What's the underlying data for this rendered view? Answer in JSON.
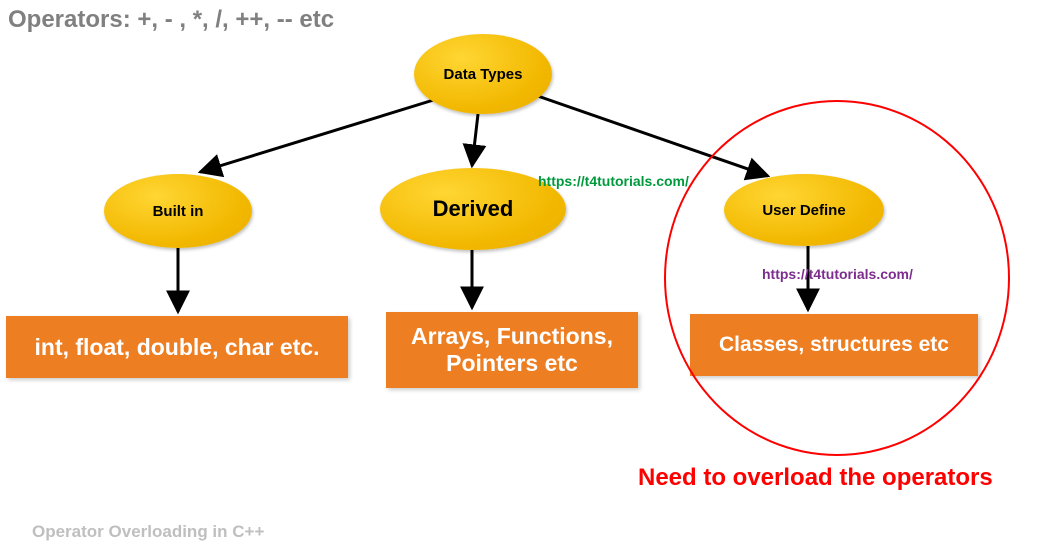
{
  "title": "Operators: +, - , *, /, ++, -- etc",
  "caption": "Operator Overloading in C++",
  "root": {
    "label": "Data Types"
  },
  "children": {
    "builtin": {
      "label": "Built in",
      "examples": "int, float, double, char etc."
    },
    "derived": {
      "label": "Derived",
      "examples": "Arrays, Functions, Pointers etc"
    },
    "userdefine": {
      "label": "User Define",
      "examples": "Classes, structures etc"
    }
  },
  "watermark": {
    "green": "https://t4tutorials.com/",
    "purple": "https://t4tutorials.com/"
  },
  "highlight_text": "Need to overload the operators"
}
